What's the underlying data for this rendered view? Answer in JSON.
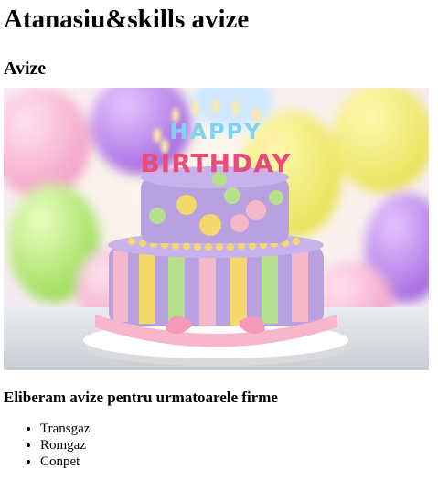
{
  "page": {
    "title": "Atanasiu&skills avize",
    "section_heading": "Avize",
    "image_text": "HAPPY BIRTHDAY",
    "subheading": "Eliberam avize pentru urmatoarele firme",
    "companies": [
      "Transgaz",
      "Romgaz",
      "Conpet"
    ]
  },
  "colors": {
    "cake_purple": "#b9a0e0",
    "frosting_pink": "#f4b8c8",
    "candle_text": [
      "#e74b7a",
      "#6ec6f0",
      "#f6d33c",
      "#7ed36a",
      "#f08a3c"
    ]
  }
}
